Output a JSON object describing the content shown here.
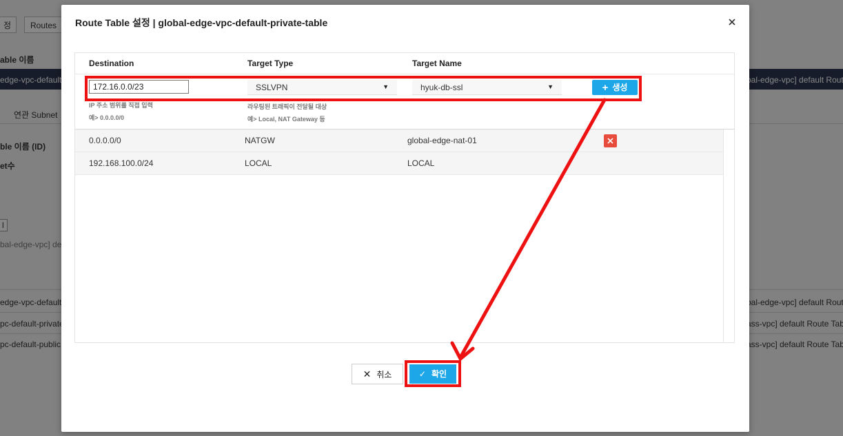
{
  "background": {
    "tab_left": "정",
    "tab_routes": "Routes",
    "col_header": "able 이름",
    "row_selected_left": "edge-vpc-default-",
    "row_selected_right": "bal-edge-vpc] default Rout",
    "subtab": "연관 Subnet",
    "detail_label_1": "ble 이름 (ID)",
    "detail_label_2": "et수",
    "small_btn": "l",
    "detail_value": "bal-edge-vpc] defa",
    "list_left": [
      "edge-vpc-default-p",
      "pc-default-private",
      "pc-default-public"
    ],
    "list_right": [
      "bal-edge-vpc] default Rout",
      "ass-vpc] default Route Tab",
      "ass-vpc] default Route Tab"
    ]
  },
  "modal": {
    "title": "Route Table 설정 | global-edge-vpc-default-private-table",
    "columns": {
      "destination": "Destination",
      "target_type": "Target Type",
      "target_name": "Target Name"
    },
    "destination_value": "172.16.0.0/23",
    "target_type_value": "SSLVPN",
    "target_name_value": "hyuk-db-ssl",
    "hint_dest_1": "IP 주소 범위를 직접 입력",
    "hint_dest_2": "예> 0.0.0.0/0",
    "hint_type_1": "라우팅된 트래픽이 전달될 대상",
    "hint_type_2": "예> Local, NAT Gateway 등",
    "create_label": "생성",
    "routes": [
      {
        "destination": "0.0.0.0/0",
        "target_type": "NATGW",
        "target_name": "global-edge-nat-01",
        "deletable": true
      },
      {
        "destination": "192.168.100.0/24",
        "target_type": "LOCAL",
        "target_name": "LOCAL",
        "deletable": false
      }
    ],
    "cancel_label": "취소",
    "confirm_label": "확인"
  },
  "annotation_color": "#ee1111",
  "accent_color": "#1ea7e8"
}
